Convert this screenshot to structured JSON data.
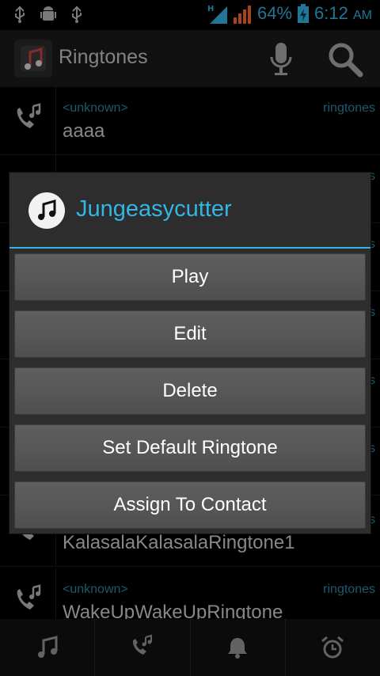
{
  "status_bar": {
    "left_icons": [
      "usb-icon",
      "android-debug-icon",
      "usb-icon"
    ],
    "network_type": "H",
    "battery_percent": "64%",
    "time": "6:12",
    "ampm": "AM",
    "accent": "#33b5e5"
  },
  "action_bar": {
    "title": "Ringtones",
    "actions": [
      "microphone-icon",
      "search-icon"
    ]
  },
  "list": {
    "rows": [
      {
        "artist": "<unknown>",
        "album": "ringtones",
        "title": "aaaa"
      },
      {
        "artist": "",
        "album": "s",
        "title": ""
      },
      {
        "artist": "",
        "album": "s",
        "title": ""
      },
      {
        "artist": "",
        "album": "s",
        "title": ""
      },
      {
        "artist": "",
        "album": "s",
        "title": ""
      },
      {
        "artist": "",
        "album": "s",
        "title": ""
      },
      {
        "artist": "",
        "album": "s",
        "title": "KalasalaKalasalaRingtone1"
      },
      {
        "artist": "<unknown>",
        "album": "ringtones",
        "title": "WakeUpWakeUpRingtone"
      }
    ]
  },
  "dialog": {
    "title": "Jungeasycutter",
    "buttons": [
      "Play",
      "Edit",
      "Delete",
      "Set Default Ringtone",
      "Assign To Contact"
    ]
  },
  "tab_bar": {
    "tabs": [
      "music-note-icon",
      "phone-music-icon",
      "bell-icon",
      "alarm-clock-icon"
    ]
  }
}
